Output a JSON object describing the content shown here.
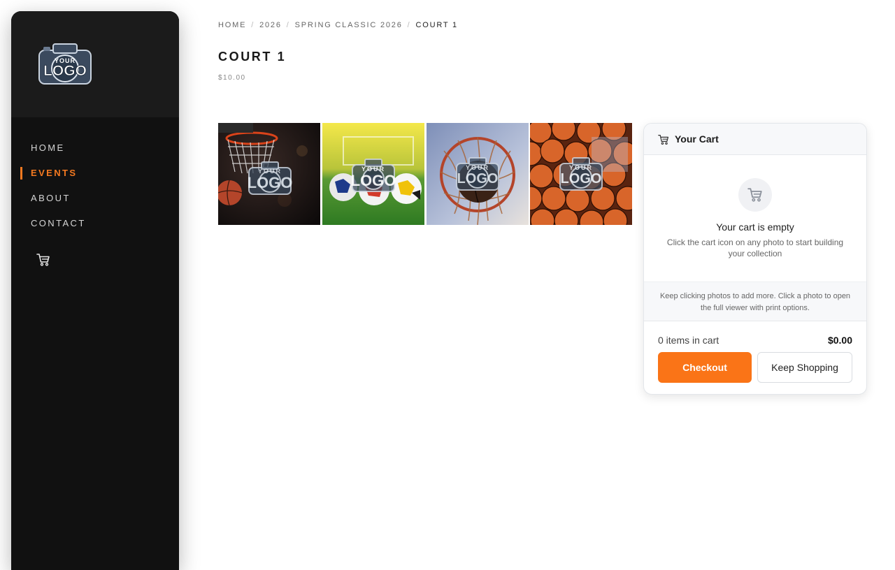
{
  "logo": {
    "text_top": "YOUR",
    "text_bottom": "LOGO"
  },
  "nav": {
    "items": [
      {
        "label": "HOME"
      },
      {
        "label": "EVENTS"
      },
      {
        "label": "ABOUT"
      },
      {
        "label": "CONTACT"
      }
    ],
    "active": "EVENTS",
    "cart_icon": "cart-icon"
  },
  "breadcrumb": {
    "items": [
      "HOME",
      "2026",
      "SPRING CLASSIC 2026",
      "COURT 1"
    ],
    "separator": "/"
  },
  "page": {
    "title": "COURT 1",
    "price": "$10.00"
  },
  "gallery": {
    "watermark_top": "YOUR",
    "watermark_bottom": "LOGO",
    "photos": [
      {
        "subject": "basketball-hoop-net"
      },
      {
        "subject": "soccer-balls-on-grass"
      },
      {
        "subject": "basketball-in-net"
      },
      {
        "subject": "pile-of-basketballs"
      }
    ]
  },
  "cart": {
    "title": "Your Cart",
    "empty_title": "Your cart is empty",
    "empty_subtitle": "Click the cart icon on any photo to start building your collection",
    "tip": "Keep clicking photos to add more. Click a photo to open the full viewer with print options.",
    "count_label": "0 items in cart",
    "total": "$0.00",
    "checkout_label": "Checkout",
    "keep_shopping_label": "Keep Shopping"
  },
  "colors": {
    "accent": "#f47920",
    "checkout": "#fa7417",
    "sidebar": "#111111"
  }
}
